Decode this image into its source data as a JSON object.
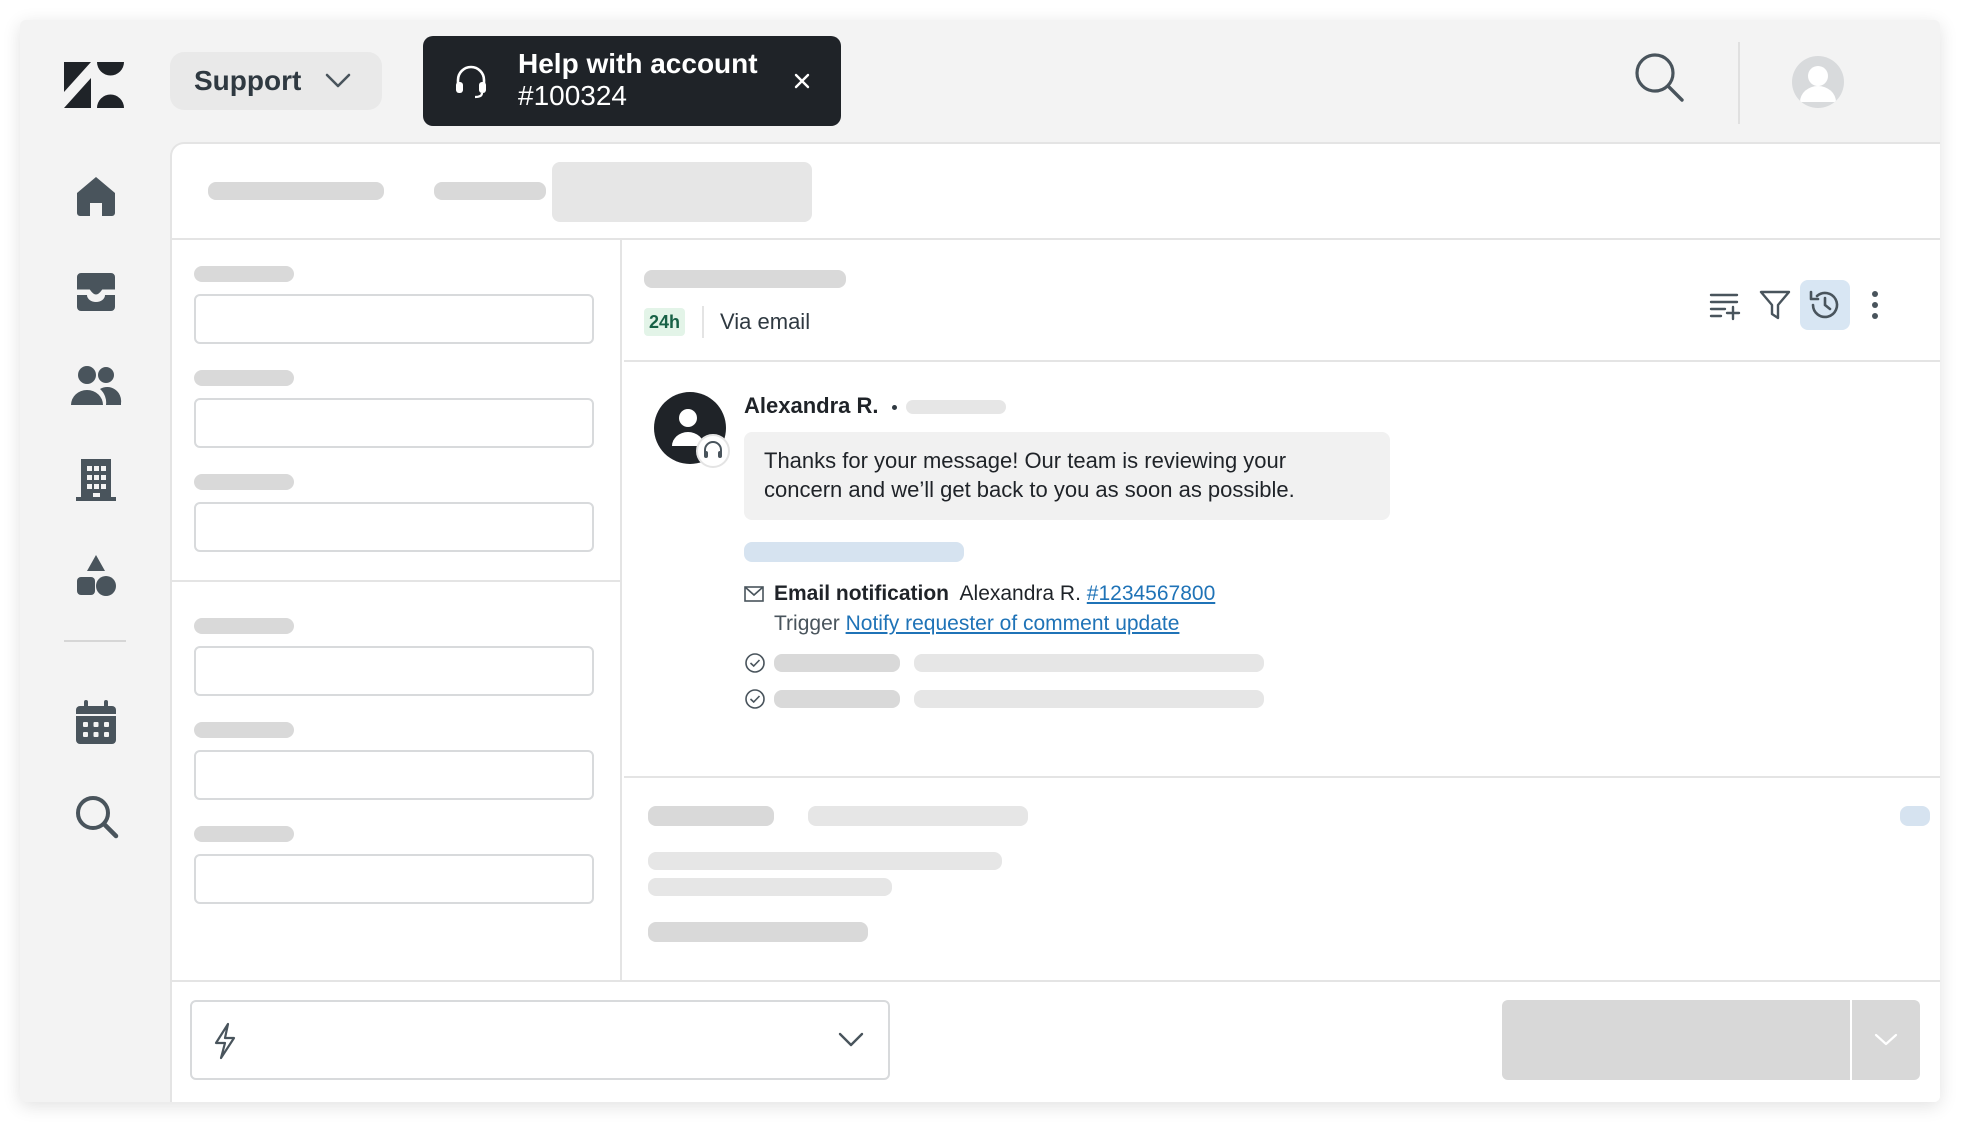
{
  "header": {
    "product_switcher": {
      "label": "Support",
      "icon": "chevron-down-icon"
    },
    "active_call": {
      "title": "Help with account",
      "ticket": "#100324",
      "icon": "headset-icon",
      "close_icon": "close-icon"
    },
    "search_icon": "search-icon",
    "avatar_icon": "user-avatar-icon"
  },
  "nav": {
    "items": [
      {
        "name": "home",
        "icon": "home-icon"
      },
      {
        "name": "views",
        "icon": "inbox-icon"
      },
      {
        "name": "customers",
        "icon": "users-icon"
      },
      {
        "name": "organizations",
        "icon": "building-icon"
      },
      {
        "name": "admin",
        "icon": "shapes-icon"
      },
      {
        "name": "calendar",
        "icon": "calendar-icon"
      },
      {
        "name": "search",
        "icon": "search-icon"
      }
    ]
  },
  "conversation": {
    "sla_badge": "24h",
    "channel": "Via email",
    "toolbar_icons": [
      "summary-icon",
      "filter-icon",
      "history-icon",
      "more-vertical-icon"
    ],
    "message": {
      "author": "Alexandra R.",
      "text": "Thanks for your message! Our team is reviewing your concern and we’ll get back to you as soon as possible."
    },
    "event": {
      "type": "Email notification",
      "recipient": "Alexandra R.",
      "link": "#1234567800",
      "trigger_label": "Trigger",
      "trigger_link": "Notify requester of comment update"
    }
  },
  "footer": {
    "macro_icon": "lightning-bolt-icon",
    "macro_chevron": "chevron-down-icon",
    "submit_chevron": "chevron-down-icon"
  },
  "colors": {
    "dark": "#1f2328",
    "link": "#1f73b7",
    "badge_bg": "#e3f4e8",
    "badge_text": "#186146",
    "active_icon_bg": "#d8e6f3"
  }
}
